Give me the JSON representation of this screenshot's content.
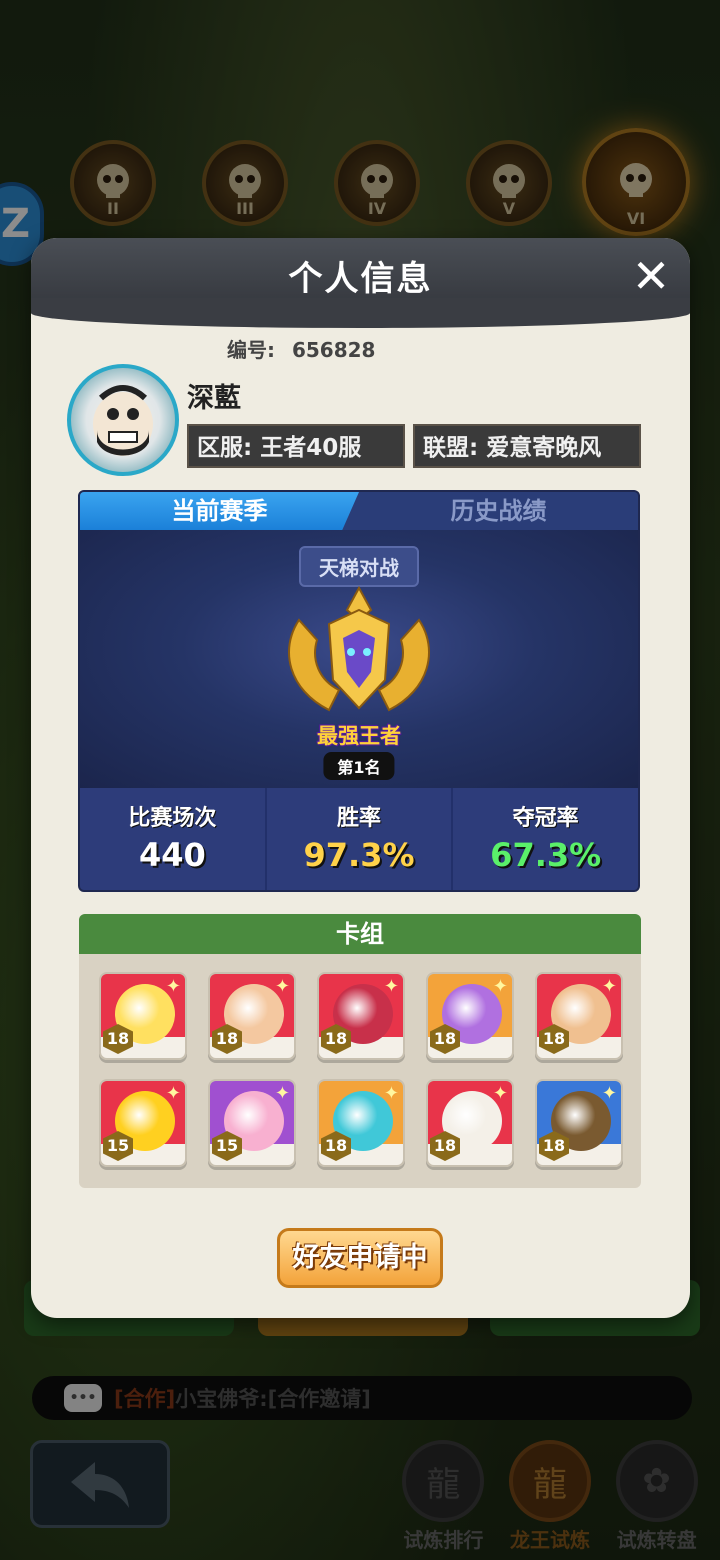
{
  "background": {
    "skulls": [
      "II",
      "III",
      "IV",
      "V",
      "VI"
    ],
    "side_badge": "Z",
    "chat": {
      "tag": "[合作]",
      "text": "小宝佛爷:[合作邀请]"
    },
    "bottom_nav": [
      {
        "label": "试炼排行",
        "icon": "dragon-emblem-icon"
      },
      {
        "label": "龙王试炼",
        "icon": "dragon-king-icon"
      },
      {
        "label": "试炼转盘",
        "icon": "wheel-icon"
      }
    ]
  },
  "modal": {
    "title": "个人信息",
    "close_icon": "close-icon",
    "player": {
      "id_label": "编号:",
      "id_value": "656828",
      "name": "深藍",
      "server": "区服: 王者40服",
      "alliance": "联盟: 爱意寄晚风"
    },
    "season": {
      "tabs": [
        "当前赛季",
        "历史战绩"
      ],
      "mode": "天梯对战",
      "rank_title": "最强王者",
      "rank_position": "第1名",
      "stats": [
        {
          "label": "比赛场次",
          "value": "440",
          "color": "#ffffff"
        },
        {
          "label": "胜率",
          "value": "97.3%",
          "color": "#ffd24a"
        },
        {
          "label": "夺冠率",
          "value": "67.3%",
          "color": "#5af06a"
        }
      ]
    },
    "deck": {
      "title": "卡组",
      "cards": [
        {
          "level": "18",
          "bg": "#e8344a",
          "face": "#ffe060",
          "icon": "hero-blonde-icon"
        },
        {
          "level": "18",
          "bg": "#e8344a",
          "face": "#f4c8a0",
          "icon": "hero-monk-icon"
        },
        {
          "level": "18",
          "bg": "#e8344a",
          "face": "#c8304a",
          "icon": "hero-swordsman-icon"
        },
        {
          "level": "18",
          "bg": "#f3a33a",
          "face": "#b070e0",
          "icon": "hero-masked-icon"
        },
        {
          "level": "18",
          "bg": "#e8344a",
          "face": "#f0c090",
          "icon": "hero-brawler-icon"
        },
        {
          "level": "15",
          "bg": "#e8344a",
          "face": "#ffd020",
          "icon": "hero-flame-icon"
        },
        {
          "level": "15",
          "bg": "#a050d0",
          "face": "#f8b0d0",
          "icon": "hero-headphone-icon"
        },
        {
          "level": "18",
          "bg": "#f3a33a",
          "face": "#40c8d8",
          "icon": "hero-cyan-hair-icon"
        },
        {
          "level": "18",
          "bg": "#e8344a",
          "face": "#f4f0e8",
          "icon": "hero-bird-icon"
        },
        {
          "level": "18",
          "bg": "#3a78d8",
          "face": "#7a5a30",
          "icon": "hero-straw-hat-icon"
        }
      ]
    },
    "friend_button": "好友申请中"
  }
}
